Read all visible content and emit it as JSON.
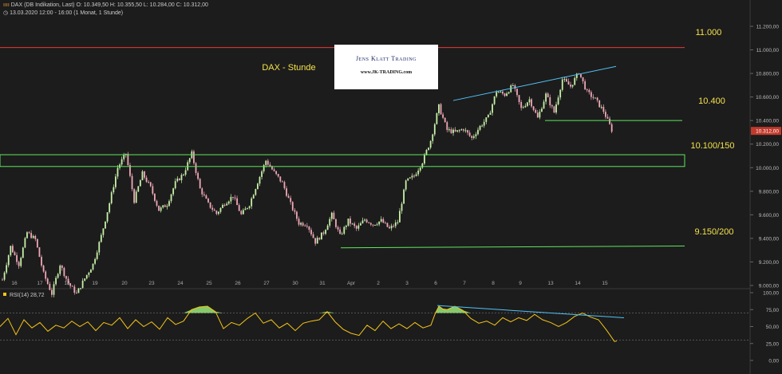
{
  "header": {
    "symbol": "DAX (DB Indikation, Last)",
    "ohlc": "O: 10.349,50  H: 10.355,50  L: 10.284,00  C: 10.312,00",
    "info": "13.03.2020 12:00 - 16:00  (1 Monat, 1 Stunde)"
  },
  "logo": {
    "brand": "Jens Klatt Trading",
    "url": "www.JK-TRADING.com"
  },
  "chart_data": [
    {
      "type": "candlestick",
      "title": "DAX - Stunde",
      "last_value": 10312,
      "last_label": "10.312,00",
      "ylim": [
        8900,
        11200
      ],
      "y_ticks": [
        9000,
        9200,
        9400,
        9600,
        9800,
        10000,
        10200,
        10400,
        10600,
        10800,
        11000,
        11200
      ],
      "y_tick_labels": [
        "9.000,00",
        "9.200,00",
        "9.400,00",
        "9.600,00",
        "9.800,00",
        "10.000,00",
        "10.200,00",
        "10.400,00",
        "10.600,00",
        "10.800,00",
        "11.000,00",
        "11.200,00"
      ],
      "x_tick_labels": [
        "16",
        "17",
        "18",
        "19",
        "20",
        "23",
        "24",
        "25",
        "26",
        "27",
        "30",
        "31",
        "Apr",
        "2",
        "3",
        "6",
        "7",
        "8",
        "9",
        "13",
        "14",
        "15"
      ],
      "grid": false,
      "series": [
        {
          "price_path": [
            [
              0,
              9050
            ],
            [
              4,
              9330
            ],
            [
              8,
              9180
            ],
            [
              12,
              9450
            ],
            [
              16,
              9390
            ],
            [
              20,
              9100
            ],
            [
              24,
              8930
            ],
            [
              28,
              9180
            ],
            [
              32,
              9020
            ],
            [
              36,
              8930
            ],
            [
              40,
              9060
            ],
            [
              44,
              9180
            ],
            [
              48,
              9420
            ],
            [
              52,
              9700
            ],
            [
              56,
              10000
            ],
            [
              60,
              10120
            ],
            [
              64,
              9720
            ],
            [
              68,
              9950
            ],
            [
              72,
              9830
            ],
            [
              76,
              9640
            ],
            [
              80,
              9690
            ],
            [
              84,
              9870
            ],
            [
              88,
              9950
            ],
            [
              92,
              10120
            ],
            [
              96,
              9820
            ],
            [
              100,
              9690
            ],
            [
              104,
              9610
            ],
            [
              108,
              9700
            ],
            [
              112,
              9760
            ],
            [
              116,
              9600
            ],
            [
              120,
              9690
            ],
            [
              124,
              9880
            ],
            [
              128,
              10060
            ],
            [
              132,
              9960
            ],
            [
              136,
              9870
            ],
            [
              140,
              9690
            ],
            [
              144,
              9530
            ],
            [
              148,
              9520
            ],
            [
              152,
              9370
            ],
            [
              156,
              9450
            ],
            [
              160,
              9600
            ],
            [
              164,
              9420
            ],
            [
              168,
              9550
            ],
            [
              172,
              9480
            ],
            [
              176,
              9560
            ],
            [
              180,
              9520
            ],
            [
              184,
              9550
            ],
            [
              188,
              9480
            ],
            [
              192,
              9540
            ],
            [
              196,
              9880
            ],
            [
              200,
              9930
            ],
            [
              204,
              10050
            ],
            [
              208,
              10230
            ],
            [
              212,
              10520
            ],
            [
              216,
              10320
            ],
            [
              220,
              10300
            ],
            [
              224,
              10330
            ],
            [
              228,
              10250
            ],
            [
              232,
              10350
            ],
            [
              236,
              10430
            ],
            [
              240,
              10650
            ],
            [
              244,
              10620
            ],
            [
              248,
              10700
            ],
            [
              252,
              10500
            ],
            [
              256,
              10580
            ],
            [
              260,
              10420
            ],
            [
              264,
              10620
            ],
            [
              268,
              10470
            ],
            [
              272,
              10750
            ],
            [
              276,
              10690
            ],
            [
              280,
              10810
            ],
            [
              284,
              10640
            ],
            [
              288,
              10580
            ],
            [
              292,
              10480
            ],
            [
              296,
              10320
            ]
          ]
        }
      ],
      "levels": [
        {
          "label": "11.000",
          "value": 11020,
          "color": "#e53935"
        },
        {
          "label": "10.400",
          "value": 10400,
          "color": "#5ee65e"
        },
        {
          "label": "10.100/150",
          "value_low": 10010,
          "value_high": 10110,
          "color": "#5ee65e"
        },
        {
          "label": "9.150/200",
          "value_start": 9320,
          "value_end": 9335,
          "color": "#5ee65e"
        }
      ],
      "trendline": {
        "start": 10570,
        "end": 10860,
        "color": "#4fc3f7"
      }
    },
    {
      "type": "line",
      "title": "RSI(14) 28,72",
      "last_value": 28.72,
      "ylim": [
        0,
        100
      ],
      "y_ticks": [
        0,
        25,
        50,
        75,
        100
      ],
      "y_tick_labels": [
        "0,00",
        "25,00",
        "50,00",
        "75,00",
        "100,00"
      ],
      "reference_lines": [
        30,
        70
      ],
      "series": [
        {
          "values_path": [
            [
              0,
              50
            ],
            [
              10,
              62
            ],
            [
              20,
              38
            ],
            [
              30,
              60
            ],
            [
              40,
              48
            ],
            [
              50,
              56
            ],
            [
              60,
              43
            ],
            [
              70,
              52
            ],
            [
              80,
              48
            ],
            [
              90,
              58
            ],
            [
              100,
              50
            ],
            [
              110,
              57
            ],
            [
              120,
              44
            ],
            [
              130,
              56
            ],
            [
              140,
              52
            ],
            [
              150,
              63
            ],
            [
              160,
              47
            ],
            [
              170,
              60
            ],
            [
              180,
              50
            ],
            [
              190,
              57
            ],
            [
              200,
              46
            ],
            [
              210,
              63
            ],
            [
              220,
              53
            ],
            [
              230,
              58
            ],
            [
              240,
              75
            ],
            [
              250,
              79
            ],
            [
              260,
              80
            ],
            [
              270,
              72
            ],
            [
              280,
              47
            ],
            [
              290,
              56
            ],
            [
              300,
              52
            ],
            [
              310,
              62
            ],
            [
              320,
              70
            ],
            [
              330,
              55
            ],
            [
              340,
              60
            ],
            [
              350,
              48
            ],
            [
              360,
              55
            ],
            [
              370,
              44
            ],
            [
              380,
              55
            ],
            [
              390,
              58
            ],
            [
              400,
              60
            ],
            [
              410,
              72
            ],
            [
              420,
              57
            ],
            [
              430,
              46
            ],
            [
              440,
              40
            ],
            [
              450,
              37
            ],
            [
              460,
              52
            ],
            [
              470,
              44
            ],
            [
              480,
              58
            ],
            [
              490,
              47
            ],
            [
              500,
              54
            ],
            [
              510,
              47
            ],
            [
              520,
              56
            ],
            [
              530,
              48
            ],
            [
              540,
              52
            ],
            [
              545,
              68
            ],
            [
              550,
              80
            ],
            [
              555,
              76
            ],
            [
              560,
              75
            ],
            [
              570,
              80
            ],
            [
              580,
              74
            ],
            [
              590,
              62
            ],
            [
              600,
              55
            ],
            [
              610,
              58
            ],
            [
              620,
              52
            ],
            [
              630,
              63
            ],
            [
              640,
              57
            ],
            [
              650,
              63
            ],
            [
              660,
              59
            ],
            [
              670,
              68
            ],
            [
              680,
              60
            ],
            [
              690,
              56
            ],
            [
              700,
              50
            ],
            [
              710,
              56
            ],
            [
              720,
              65
            ],
            [
              730,
              70
            ],
            [
              740,
              64
            ],
            [
              750,
              60
            ],
            [
              760,
              45
            ],
            [
              770,
              28
            ],
            [
              773,
              28.7
            ]
          ]
        }
      ],
      "trendline": {
        "start": 81,
        "end": 63,
        "color": "#4fc3f7"
      }
    }
  ]
}
